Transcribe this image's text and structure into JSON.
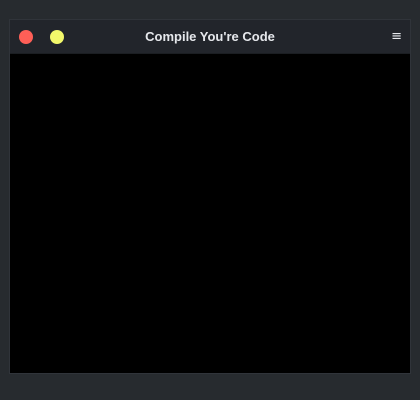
{
  "window": {
    "title": "Compile You're Code",
    "menu_icon": "hamburger-icon",
    "menu_glyph": "≡",
    "controls": {
      "close": {
        "icon": "close-dot-icon",
        "color": "#ff5f57"
      },
      "minimize": {
        "icon": "minimize-dot-icon",
        "color": "#f2f86b"
      }
    }
  },
  "content": {
    "background": "#000000"
  }
}
